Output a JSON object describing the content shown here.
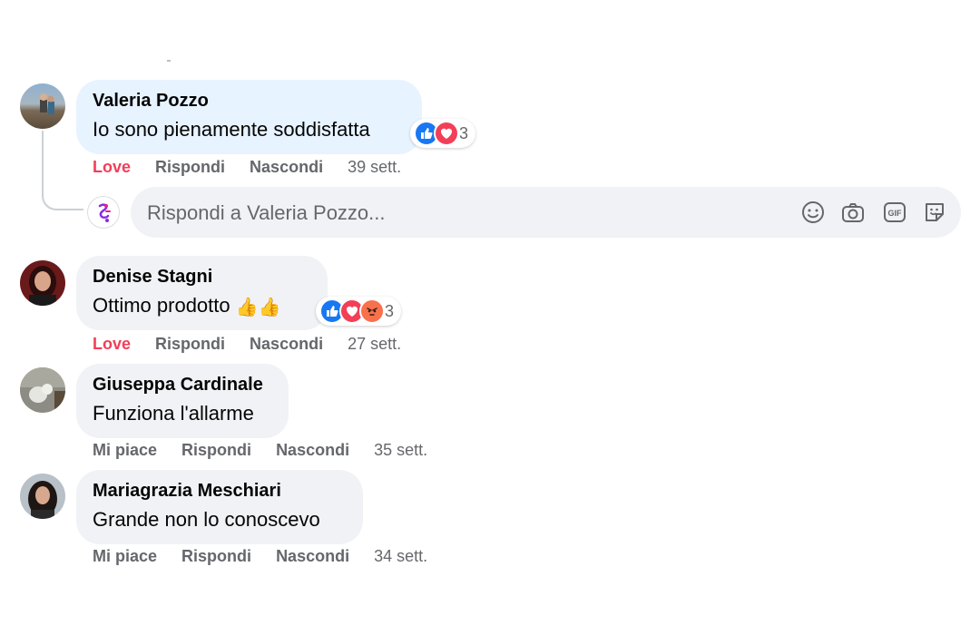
{
  "comments": [
    {
      "author": "Valeria Pozzo",
      "text": "Io sono pienamente soddisfatta",
      "reaction_count": "3",
      "reactions": [
        "like-icon",
        "love-icon"
      ],
      "actions": {
        "react": "Love",
        "reply": "Rispondi",
        "hide": "Nascondi",
        "time": "39 sett."
      }
    },
    {
      "author": "Denise Stagni",
      "text": "Ottimo prodotto",
      "text_emoji": "👍👍",
      "reaction_count": "3",
      "reactions": [
        "like-icon",
        "love-icon",
        "angry-icon"
      ],
      "actions": {
        "react": "Love",
        "reply": "Rispondi",
        "hide": "Nascondi",
        "time": "27 sett."
      }
    },
    {
      "author": "Giuseppa Cardinale",
      "text": "Funziona l'allarme",
      "actions": {
        "react": "Mi piace",
        "reply": "Rispondi",
        "hide": "Nascondi",
        "time": "35 sett."
      }
    },
    {
      "author": "Mariagrazia Meschiari",
      "text": "Grande non lo conoscevo",
      "actions": {
        "react": "Mi piace",
        "reply": "Rispondi",
        "hide": "Nascondi",
        "time": "34 sett."
      }
    }
  ],
  "reply": {
    "placeholder": "Rispondi a Valeria Pozzo...",
    "tools": [
      "emoji-icon",
      "camera-icon",
      "gif-icon",
      "sticker-icon"
    ]
  },
  "colors": {
    "love": "#f33e58",
    "like": "#1877f2",
    "bubble": "#f0f2f5",
    "bubble_highlight": "#e7f3ff",
    "meta": "#65676b"
  }
}
